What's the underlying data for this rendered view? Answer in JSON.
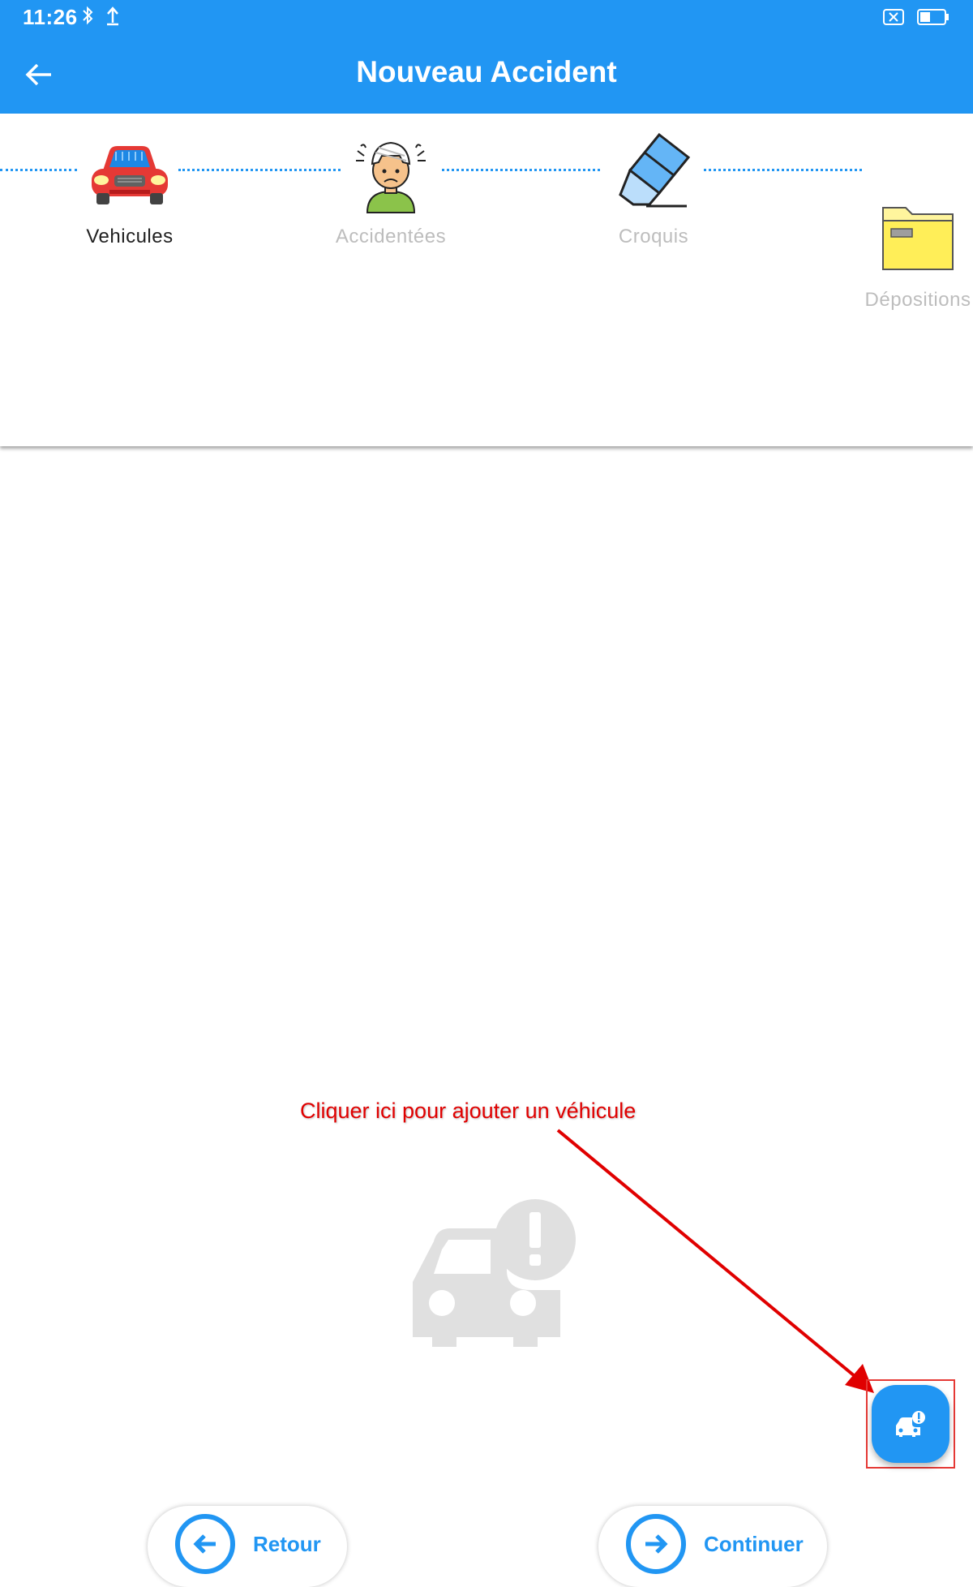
{
  "status_bar": {
    "time": "11:26",
    "left_icons": [
      "bluetooth-icon",
      "upload-icon"
    ],
    "right_icons": [
      "no-sim-icon",
      "battery-icon"
    ]
  },
  "app_bar": {
    "title": "Nouveau Accident",
    "back_icon": "arrow-back-icon",
    "background": "#2196f3"
  },
  "stepper": {
    "steps": [
      {
        "label": "Vehicules",
        "icon": "red-car-icon",
        "active": true
      },
      {
        "label": "Accidentées",
        "icon": "injured-person-icon",
        "active": false
      },
      {
        "label": "Croquis",
        "icon": "eraser-icon",
        "active": false
      },
      {
        "label": "Dépositions",
        "icon": "folder-icon",
        "active": false
      }
    ],
    "active_color": "#212121",
    "inactive_color": "#bdbdbd",
    "connector_color": "#2196f3"
  },
  "empty_state": {
    "icon": "car-alert-icon"
  },
  "annotation": {
    "hint": "Cliquer ici pour ajouter un véhicule",
    "color": "#e00000"
  },
  "fab": {
    "icon": "add-vehicle-icon"
  },
  "navigation": {
    "back_label": "Retour",
    "back_icon": "arrow-left-circle-icon",
    "next_label": "Continuer",
    "next_icon": "arrow-right-circle-icon"
  }
}
